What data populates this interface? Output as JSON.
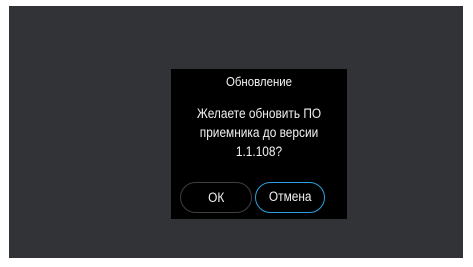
{
  "dialog": {
    "title": "Обновление",
    "message": "Желаете обновить ПО\nприемника до версии\n1.1.108?",
    "buttons": {
      "ok_label": "ОК",
      "cancel_label": "Отмена"
    }
  },
  "colors": {
    "screen_background": "#323337",
    "dialog_background": "#000000",
    "focus_accent": "#2f9fe0"
  }
}
